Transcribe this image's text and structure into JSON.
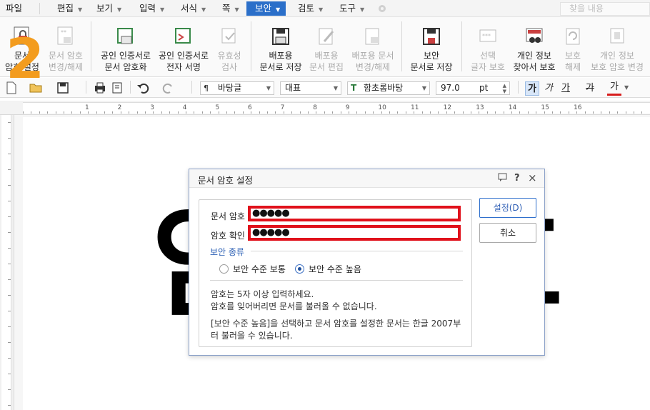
{
  "menubar": {
    "items": [
      {
        "label": "파일",
        "has_arrow": false
      },
      {
        "label": "편집",
        "has_arrow": true
      },
      {
        "label": "보기",
        "has_arrow": true
      },
      {
        "label": "입력",
        "has_arrow": true
      },
      {
        "label": "서식",
        "has_arrow": true
      },
      {
        "label": "쪽",
        "has_arrow": true
      },
      {
        "label": "보안",
        "has_arrow": true,
        "active": true
      },
      {
        "label": "검토",
        "has_arrow": true
      },
      {
        "label": "도구",
        "has_arrow": true
      }
    ],
    "search_placeholder": "찾을 내용"
  },
  "ribbon": {
    "buttons": [
      {
        "label": "문서\n암호 설정",
        "enabled": true,
        "icon": "lock-doc-icon"
      },
      {
        "label": "문서 암호\n변경/해제",
        "enabled": false,
        "icon": "key-doc-icon"
      },
      {
        "label": "공인 인증서로\n문서 암호화",
        "enabled": true,
        "icon": "cert-encrypt-icon"
      },
      {
        "label": "공인 인증서로\n전자 서명",
        "enabled": true,
        "icon": "cert-sign-icon"
      },
      {
        "label": "유효성\n검사",
        "enabled": false,
        "icon": "validate-icon"
      },
      {
        "label": "배포용\n문서로 저장",
        "enabled": true,
        "icon": "distribute-save-icon"
      },
      {
        "label": "배포용\n문서 편집",
        "enabled": false,
        "icon": "distribute-edit-icon"
      },
      {
        "label": "배포용 문서\n변경/해제",
        "enabled": false,
        "icon": "distribute-change-icon"
      },
      {
        "label": "보안\n문서로 저장",
        "enabled": true,
        "icon": "secure-save-icon"
      },
      {
        "label": "선택\n글자 보호",
        "enabled": false,
        "icon": "protect-text-icon"
      },
      {
        "label": "개인 정보\n찾아서 보호",
        "enabled": true,
        "icon": "privacy-find-icon"
      },
      {
        "label": "보호\n해제",
        "enabled": false,
        "icon": "unprotect-icon"
      },
      {
        "label": "개인 정보\n보호 암호 변경",
        "enabled": false,
        "icon": "privacy-pw-icon"
      }
    ],
    "overlay_number": "2"
  },
  "toolbar": {
    "style_combo": "바탕글",
    "lang_combo": "대표",
    "font_combo": "함초롬바탕",
    "size_value": "97.0",
    "size_unit": "pt",
    "bold_glyph": "가",
    "italic_glyph": "가",
    "underline_glyph": "가",
    "strike_glyph": "가",
    "color_glyph": "가"
  },
  "ruler": {
    "numbers": [
      "1",
      "2",
      "3",
      "4",
      "5",
      "6",
      "7",
      "8",
      "9",
      "10",
      "11",
      "12",
      "13",
      "14",
      "15",
      "16"
    ]
  },
  "document": {
    "big_line1": "암",
    "big_line2": "호"
  },
  "dialog": {
    "title": "문서 암호 설정",
    "password_label": "문서 암호",
    "password_value": "●●●●●",
    "confirm_label": "암호 확인",
    "confirm_value": "●●●●●",
    "security_section": "보안 종류",
    "radio_low": "보안 수준 보통",
    "radio_high": "보안 수준 높음",
    "selected": "high",
    "note1": "암호는 5자 이상 입력하세요.",
    "note2": "암호를 잊어버리면 문서를 불러올 수 없습니다.",
    "note3": "[보안 수준 높음]을 선택하고 문서 암호를 설정한 문서는 한글 2007부",
    "note4": "터 불러올 수 있습니다.",
    "set_button": "설정(D)",
    "cancel_button": "취소",
    "help_glyph": "?",
    "close_glyph": "×"
  },
  "colors": {
    "accent": "#2b6fc9",
    "highlight_red": "#e0111b",
    "overlay_orange": "#f39c1e",
    "section_blue": "#2b5fb4"
  }
}
